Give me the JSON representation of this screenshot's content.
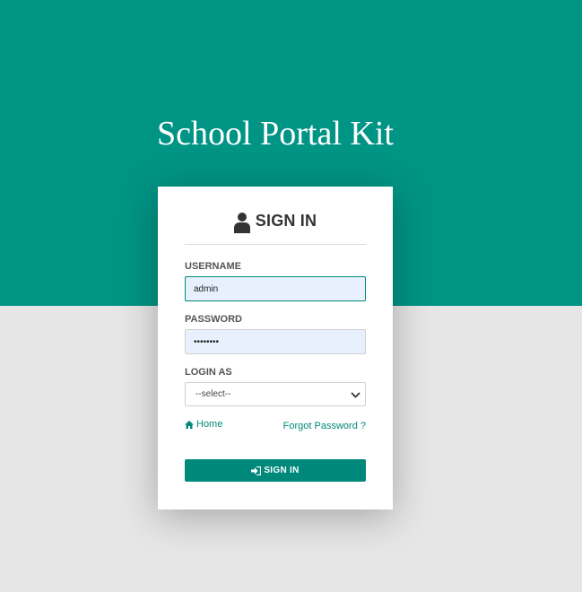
{
  "app": {
    "title": "School Portal Kit"
  },
  "login": {
    "heading": "SIGN IN",
    "username": {
      "label": "USERNAME",
      "value": "admin"
    },
    "password": {
      "label": "PASSWORD",
      "value": "••••••••"
    },
    "login_as": {
      "label": "LOGIN AS",
      "selected": "--select--"
    },
    "home_link": "Home",
    "forgot_link": "Forgot Password ?",
    "submit_label": "SIGN IN"
  },
  "icons": {
    "heading": "user-icon",
    "home": "home-icon",
    "submit": "sign-in-icon",
    "select": "chevron-down-icon"
  },
  "colors": {
    "brand": "#009485",
    "accent": "#00897b",
    "background": "#e6e6e6",
    "input_fill": "#e8f0fe"
  }
}
